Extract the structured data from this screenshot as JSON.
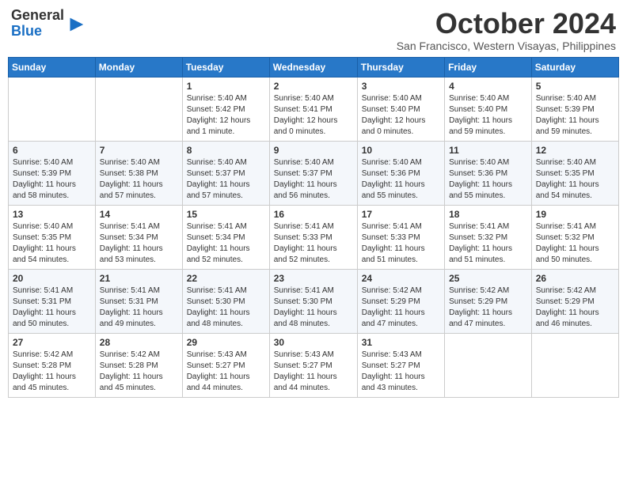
{
  "header": {
    "logo_line1": "General",
    "logo_line2": "Blue",
    "month": "October 2024",
    "location": "San Francisco, Western Visayas, Philippines"
  },
  "weekdays": [
    "Sunday",
    "Monday",
    "Tuesday",
    "Wednesday",
    "Thursday",
    "Friday",
    "Saturday"
  ],
  "weeks": [
    [
      {
        "day": "",
        "info": ""
      },
      {
        "day": "",
        "info": ""
      },
      {
        "day": "1",
        "info": "Sunrise: 5:40 AM\nSunset: 5:42 PM\nDaylight: 12 hours\nand 1 minute."
      },
      {
        "day": "2",
        "info": "Sunrise: 5:40 AM\nSunset: 5:41 PM\nDaylight: 12 hours\nand 0 minutes."
      },
      {
        "day": "3",
        "info": "Sunrise: 5:40 AM\nSunset: 5:40 PM\nDaylight: 12 hours\nand 0 minutes."
      },
      {
        "day": "4",
        "info": "Sunrise: 5:40 AM\nSunset: 5:40 PM\nDaylight: 11 hours\nand 59 minutes."
      },
      {
        "day": "5",
        "info": "Sunrise: 5:40 AM\nSunset: 5:39 PM\nDaylight: 11 hours\nand 59 minutes."
      }
    ],
    [
      {
        "day": "6",
        "info": "Sunrise: 5:40 AM\nSunset: 5:39 PM\nDaylight: 11 hours\nand 58 minutes."
      },
      {
        "day": "7",
        "info": "Sunrise: 5:40 AM\nSunset: 5:38 PM\nDaylight: 11 hours\nand 57 minutes."
      },
      {
        "day": "8",
        "info": "Sunrise: 5:40 AM\nSunset: 5:37 PM\nDaylight: 11 hours\nand 57 minutes."
      },
      {
        "day": "9",
        "info": "Sunrise: 5:40 AM\nSunset: 5:37 PM\nDaylight: 11 hours\nand 56 minutes."
      },
      {
        "day": "10",
        "info": "Sunrise: 5:40 AM\nSunset: 5:36 PM\nDaylight: 11 hours\nand 55 minutes."
      },
      {
        "day": "11",
        "info": "Sunrise: 5:40 AM\nSunset: 5:36 PM\nDaylight: 11 hours\nand 55 minutes."
      },
      {
        "day": "12",
        "info": "Sunrise: 5:40 AM\nSunset: 5:35 PM\nDaylight: 11 hours\nand 54 minutes."
      }
    ],
    [
      {
        "day": "13",
        "info": "Sunrise: 5:40 AM\nSunset: 5:35 PM\nDaylight: 11 hours\nand 54 minutes."
      },
      {
        "day": "14",
        "info": "Sunrise: 5:41 AM\nSunset: 5:34 PM\nDaylight: 11 hours\nand 53 minutes."
      },
      {
        "day": "15",
        "info": "Sunrise: 5:41 AM\nSunset: 5:34 PM\nDaylight: 11 hours\nand 52 minutes."
      },
      {
        "day": "16",
        "info": "Sunrise: 5:41 AM\nSunset: 5:33 PM\nDaylight: 11 hours\nand 52 minutes."
      },
      {
        "day": "17",
        "info": "Sunrise: 5:41 AM\nSunset: 5:33 PM\nDaylight: 11 hours\nand 51 minutes."
      },
      {
        "day": "18",
        "info": "Sunrise: 5:41 AM\nSunset: 5:32 PM\nDaylight: 11 hours\nand 51 minutes."
      },
      {
        "day": "19",
        "info": "Sunrise: 5:41 AM\nSunset: 5:32 PM\nDaylight: 11 hours\nand 50 minutes."
      }
    ],
    [
      {
        "day": "20",
        "info": "Sunrise: 5:41 AM\nSunset: 5:31 PM\nDaylight: 11 hours\nand 50 minutes."
      },
      {
        "day": "21",
        "info": "Sunrise: 5:41 AM\nSunset: 5:31 PM\nDaylight: 11 hours\nand 49 minutes."
      },
      {
        "day": "22",
        "info": "Sunrise: 5:41 AM\nSunset: 5:30 PM\nDaylight: 11 hours\nand 48 minutes."
      },
      {
        "day": "23",
        "info": "Sunrise: 5:41 AM\nSunset: 5:30 PM\nDaylight: 11 hours\nand 48 minutes."
      },
      {
        "day": "24",
        "info": "Sunrise: 5:42 AM\nSunset: 5:29 PM\nDaylight: 11 hours\nand 47 minutes."
      },
      {
        "day": "25",
        "info": "Sunrise: 5:42 AM\nSunset: 5:29 PM\nDaylight: 11 hours\nand 47 minutes."
      },
      {
        "day": "26",
        "info": "Sunrise: 5:42 AM\nSunset: 5:29 PM\nDaylight: 11 hours\nand 46 minutes."
      }
    ],
    [
      {
        "day": "27",
        "info": "Sunrise: 5:42 AM\nSunset: 5:28 PM\nDaylight: 11 hours\nand 45 minutes."
      },
      {
        "day": "28",
        "info": "Sunrise: 5:42 AM\nSunset: 5:28 PM\nDaylight: 11 hours\nand 45 minutes."
      },
      {
        "day": "29",
        "info": "Sunrise: 5:43 AM\nSunset: 5:27 PM\nDaylight: 11 hours\nand 44 minutes."
      },
      {
        "day": "30",
        "info": "Sunrise: 5:43 AM\nSunset: 5:27 PM\nDaylight: 11 hours\nand 44 minutes."
      },
      {
        "day": "31",
        "info": "Sunrise: 5:43 AM\nSunset: 5:27 PM\nDaylight: 11 hours\nand 43 minutes."
      },
      {
        "day": "",
        "info": ""
      },
      {
        "day": "",
        "info": ""
      }
    ]
  ]
}
